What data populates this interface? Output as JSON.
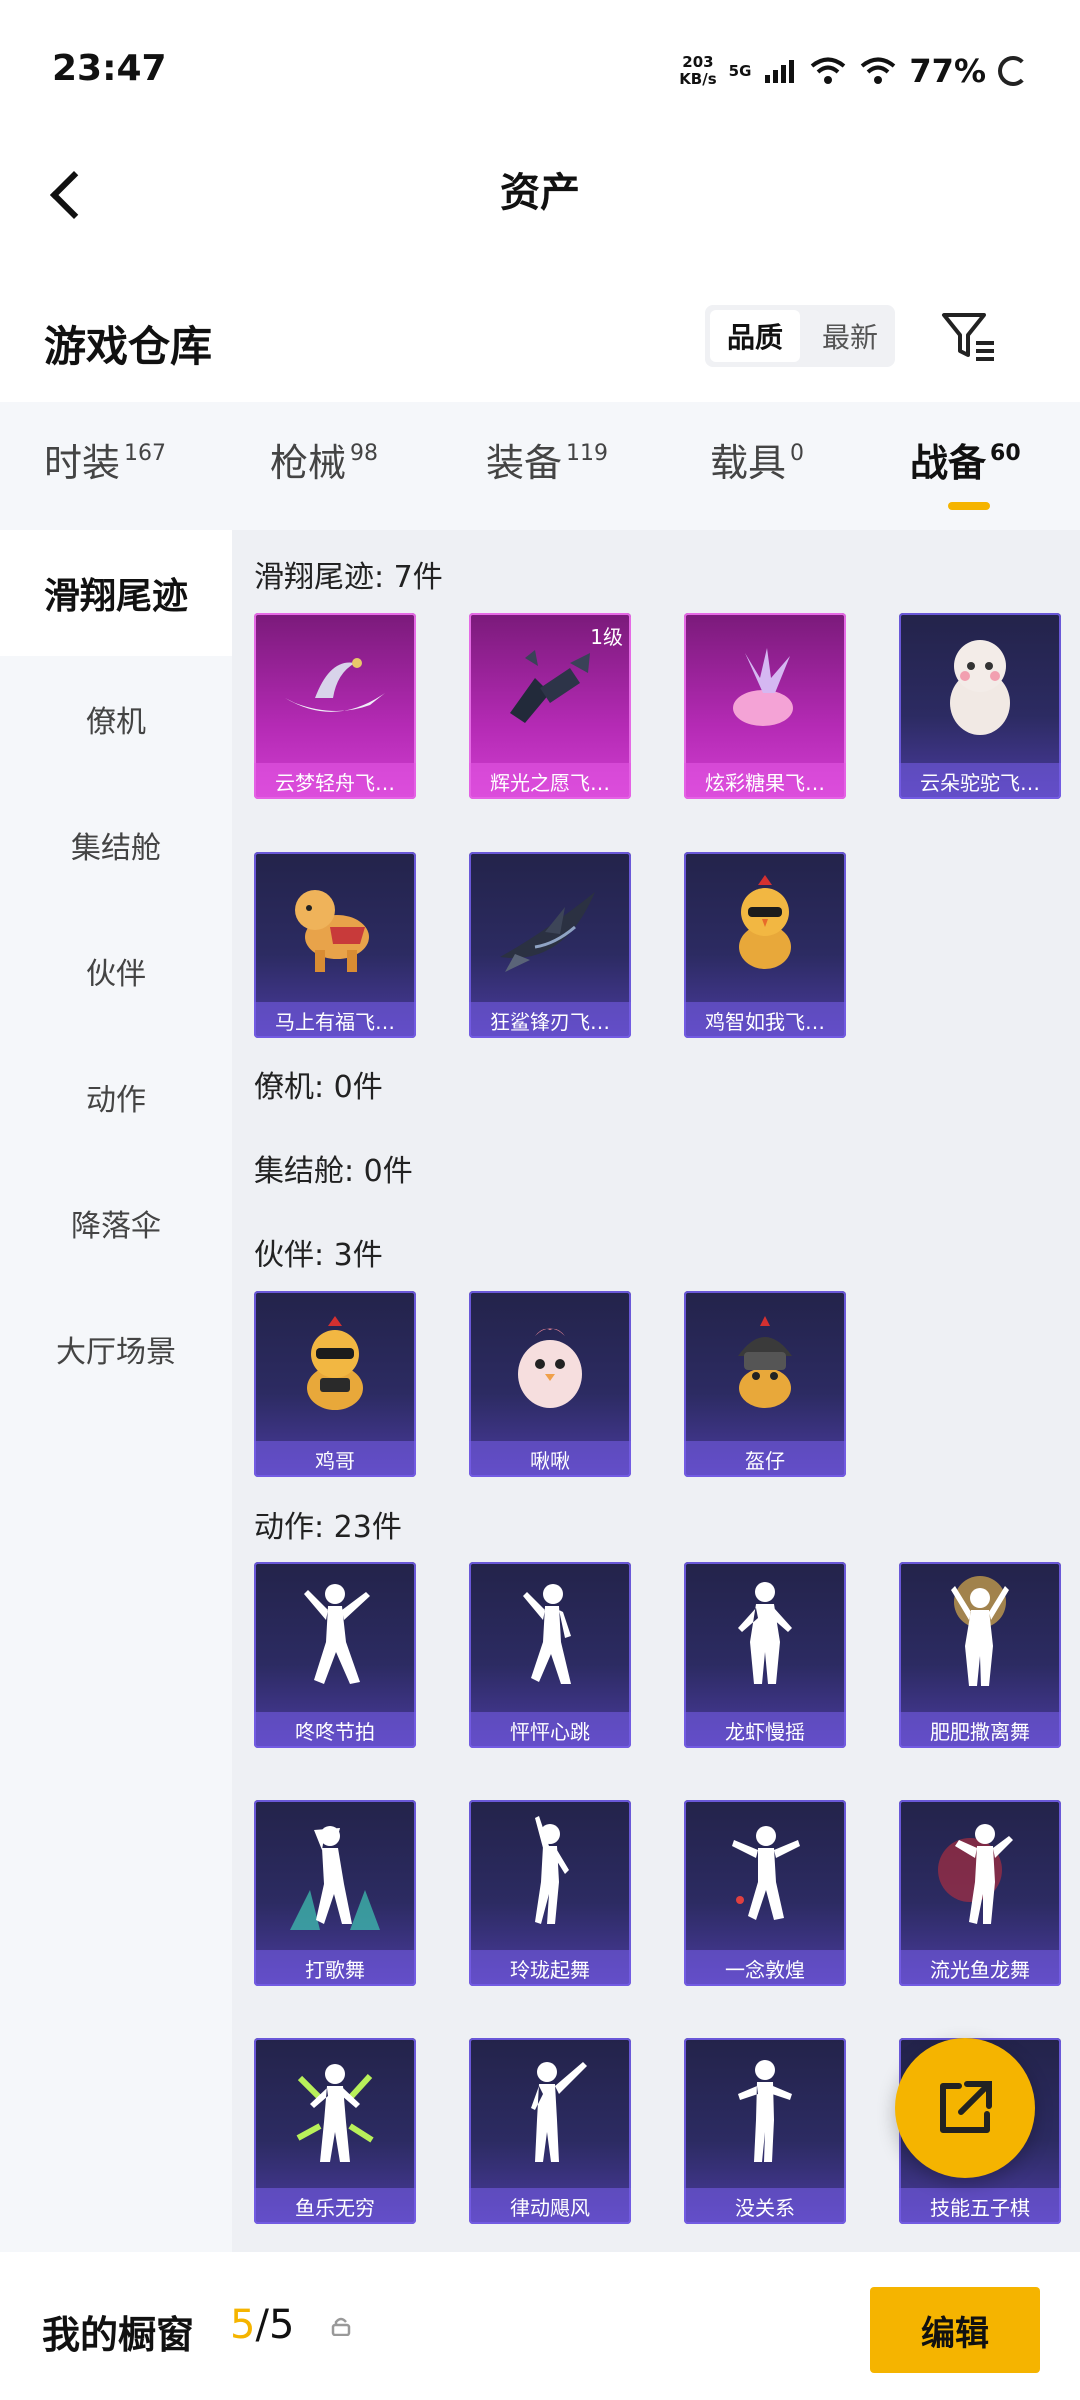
{
  "status_bar": {
    "time": "23:47",
    "net_speed_value": "203",
    "net_speed_unit": "KB/s",
    "network": "5G",
    "battery": "77%"
  },
  "header": {
    "title": "资产"
  },
  "warehouse": {
    "title": "游戏仓库",
    "sort_options": [
      "品质",
      "最新"
    ],
    "active_sort": "品质"
  },
  "tabs": [
    {
      "label": "时装",
      "count": "167"
    },
    {
      "label": "枪械",
      "count": "98"
    },
    {
      "label": "装备",
      "count": "119"
    },
    {
      "label": "载具",
      "count": "0"
    },
    {
      "label": "战备",
      "count": "60",
      "active": true
    }
  ],
  "sidebar": [
    {
      "label": "滑翔尾迹",
      "active": true
    },
    {
      "label": "僚机"
    },
    {
      "label": "集结舱"
    },
    {
      "label": "伙伴"
    },
    {
      "label": "动作"
    },
    {
      "label": "降落伞"
    },
    {
      "label": "大厅场景"
    }
  ],
  "sections": {
    "glide": {
      "title": "滑翔尾迹: 7件",
      "items": [
        {
          "label": "云梦轻舟飞…",
          "rarity": "pink",
          "icon": "boat-icon"
        },
        {
          "label": "辉光之愿飞…",
          "rarity": "pink",
          "level": "1级",
          "icon": "crystal-shard-icon"
        },
        {
          "label": "炫彩糖果飞…",
          "rarity": "pink",
          "icon": "candy-icon"
        },
        {
          "label": "云朵驼驼飞…",
          "rarity": "purple",
          "icon": "alpaca-icon"
        },
        {
          "label": "马上有福飞…",
          "rarity": "purple",
          "icon": "horse-icon"
        },
        {
          "label": "狂鲨锋刃飞…",
          "rarity": "purple",
          "icon": "shark-icon"
        },
        {
          "label": "鸡智如我飞…",
          "rarity": "purple",
          "icon": "chicken-icon"
        }
      ]
    },
    "wingman": {
      "title": "僚机: 0件"
    },
    "capsule": {
      "title": "集结舱: 0件"
    },
    "partner": {
      "title": "伙伴: 3件",
      "items": [
        {
          "label": "鸡哥",
          "icon": "chicken-icon"
        },
        {
          "label": "啾啾",
          "icon": "bird-icon"
        },
        {
          "label": "盔仔",
          "icon": "helmet-chick-icon"
        }
      ]
    },
    "emote": {
      "title": "动作: 23件",
      "items": [
        {
          "label": "咚咚节拍",
          "icon": "dancer-icon"
        },
        {
          "label": "怦怦心跳",
          "icon": "dancer-icon"
        },
        {
          "label": "龙虾慢摇",
          "icon": "dancer-icon"
        },
        {
          "label": "肥肥撒离舞",
          "icon": "dancer-icon"
        },
        {
          "label": "打歌舞",
          "icon": "dancer-icon"
        },
        {
          "label": "玲珑起舞",
          "icon": "dancer-icon"
        },
        {
          "label": "一念敦煌",
          "icon": "dancer-icon"
        },
        {
          "label": "流光鱼龙舞",
          "icon": "dancer-icon"
        },
        {
          "label": "鱼乐无穷",
          "icon": "dancer-icon"
        },
        {
          "label": "律动飓风",
          "icon": "dancer-icon"
        },
        {
          "label": "没关系",
          "icon": "dancer-icon"
        },
        {
          "label": "技能五子棋",
          "icon": "dancer-icon"
        }
      ]
    }
  },
  "bottom_bar": {
    "label": "我的橱窗",
    "current": "5",
    "separator": "/",
    "total": "5",
    "edit_label": "编辑"
  },
  "colors": {
    "accent": "#f5b400",
    "card_purple": "#2c2b62",
    "card_pink": "#b42ab4"
  }
}
